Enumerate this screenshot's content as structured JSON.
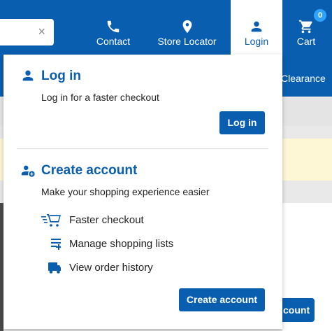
{
  "header": {
    "search_clear_glyph": "×",
    "nav": {
      "contact": "Contact",
      "store_locator": "Store Locator",
      "login": "Login",
      "cart": "Cart",
      "cart_count": "0"
    }
  },
  "background": {
    "clearance": "Clearance",
    "partial_button": "count"
  },
  "login_panel": {
    "login_title": "Log in",
    "login_subtitle": "Log in for a faster checkout",
    "login_button": "Log in",
    "create_title": "Create account",
    "create_subtitle": "Make your shopping experience easier",
    "benefits": [
      {
        "icon": "fast-cart-icon",
        "label": "Faster checkout"
      },
      {
        "icon": "playlist-add-icon",
        "label": "Manage shopping lists"
      },
      {
        "icon": "truck-icon",
        "label": "View order history"
      }
    ],
    "create_button": "Create account"
  },
  "colors": {
    "brand_blue": "#0a5eb0",
    "badge_blue": "#2fa4ff"
  }
}
